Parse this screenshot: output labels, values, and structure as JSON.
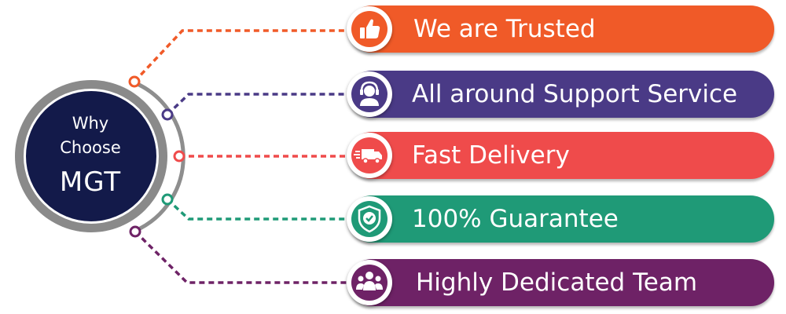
{
  "hub": {
    "line1": "Why",
    "line2": "Choose",
    "line3": "MGT"
  },
  "items": [
    {
      "label": "We are Trusted",
      "color": "#f05a28",
      "icon": "thumbs-up-icon"
    },
    {
      "label": "All around Support Service",
      "color": "#4a3a86",
      "icon": "headset-support-icon"
    },
    {
      "label": "Fast Delivery",
      "color": "#ef4b4b",
      "icon": "delivery-truck-icon"
    },
    {
      "label": "100% Guarantee",
      "color": "#1f9a77",
      "icon": "shield-check-icon"
    },
    {
      "label": "Highly Dedicated Team",
      "color": "#6e2266",
      "icon": "team-icon"
    }
  ]
}
